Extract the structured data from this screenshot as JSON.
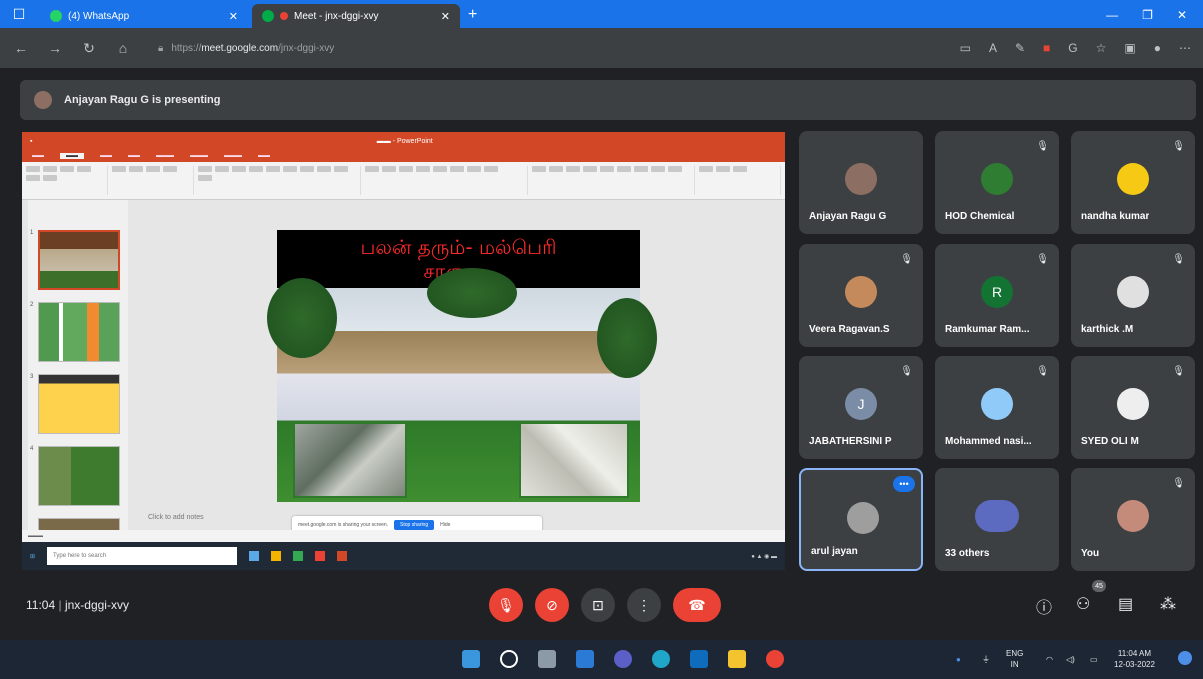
{
  "browser": {
    "tabs": [
      {
        "label": "(4) WhatsApp",
        "active": false
      },
      {
        "label": "Meet - jnx-dggi-xvy",
        "active": true
      }
    ],
    "url_prefix": "https://",
    "url_host": "meet.google.com",
    "url_path": "/jnx-dggi-xvy"
  },
  "banner": {
    "text": "Anjayan Ragu G is presenting"
  },
  "presentation": {
    "slide_title_line1": "பலன் தரும்- மல்பெரி",
    "slide_title_line2": "சாகுபடி",
    "notes_placeholder": "Click to add notes",
    "share_notice": "meet.google.com is sharing your screen.",
    "stop_sharing": "Stop sharing",
    "hide": "Hide",
    "taskbar_search": "Type here to search"
  },
  "participants": [
    {
      "name": "Anjayan Ragu G",
      "avatar": "photo",
      "color": "#8d6e63",
      "muted": false
    },
    {
      "name": "HOD Chemical",
      "avatar": "photo",
      "color": "#2e7d32",
      "muted": true
    },
    {
      "name": "nandha kumar",
      "avatar": "photo",
      "color": "#f6c915",
      "muted": true
    },
    {
      "name": "Veera Ragavan.S",
      "avatar": "photo",
      "color": "#c58a5c",
      "muted": true
    },
    {
      "name": "Ramkumar Ram...",
      "avatar": "R",
      "color": "#137333",
      "muted": true
    },
    {
      "name": "karthick .M",
      "avatar": "photo",
      "color": "#e0e0e0",
      "muted": true
    },
    {
      "name": "JABATHERSINI P",
      "avatar": "J",
      "color": "#7b8ca6",
      "muted": true
    },
    {
      "name": "Mohammed nasi...",
      "avatar": "photo",
      "color": "#90caf9",
      "muted": true
    },
    {
      "name": "SYED OLI M",
      "avatar": "photo",
      "color": "#eeeeee",
      "muted": true
    },
    {
      "name": "arul jayan",
      "avatar": "photo",
      "color": "#9e9e9e",
      "muted": false
    },
    {
      "name": "33 others",
      "avatar": "group",
      "color": "#5c6bc0",
      "muted": false
    },
    {
      "name": "You",
      "avatar": "photo",
      "color": "#c48b7a",
      "muted": true
    }
  ],
  "meeting": {
    "time": "11:04",
    "code": "jnx-dggi-xvy",
    "people_count": "45"
  },
  "system": {
    "lang_top": "ENG",
    "lang_bottom": "IN",
    "clock_time": "11:04 AM",
    "clock_date": "12-03-2022"
  }
}
